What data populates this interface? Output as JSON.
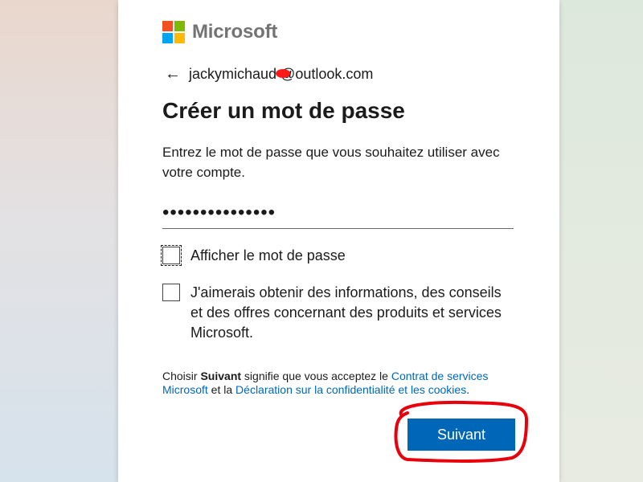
{
  "brand": {
    "name": "Microsoft",
    "colors": [
      "#f25022",
      "#7fba00",
      "#00a4ef",
      "#ffb900"
    ]
  },
  "identity": {
    "back_icon": "arrow-left-icon",
    "email": "jackymichaud  @outlook.com"
  },
  "title": "Créer un mot de passe",
  "description": "Entrez le mot de passe que vous souhaitez utiliser avec votre compte.",
  "password": {
    "masked_value": "•••••••••••••••"
  },
  "checkboxes": [
    {
      "label": "Afficher le mot de passe",
      "checked": false
    },
    {
      "label": "J'aimerais obtenir des informations, des conseils et des offres concernant des produits et services Microsoft.",
      "checked": false
    }
  ],
  "legal": {
    "prefix": "Choisir ",
    "bold": "Suivant",
    "middle": " signifie que vous acceptez le ",
    "link1": "Contrat de services Microsoft",
    "and": " et la ",
    "link2": "Déclaration sur la confidentialité et les cookies",
    "suffix": "."
  },
  "next_button": {
    "label": "Suivant"
  },
  "colors": {
    "accent": "#0067b8",
    "annotation": "#e8000b"
  }
}
